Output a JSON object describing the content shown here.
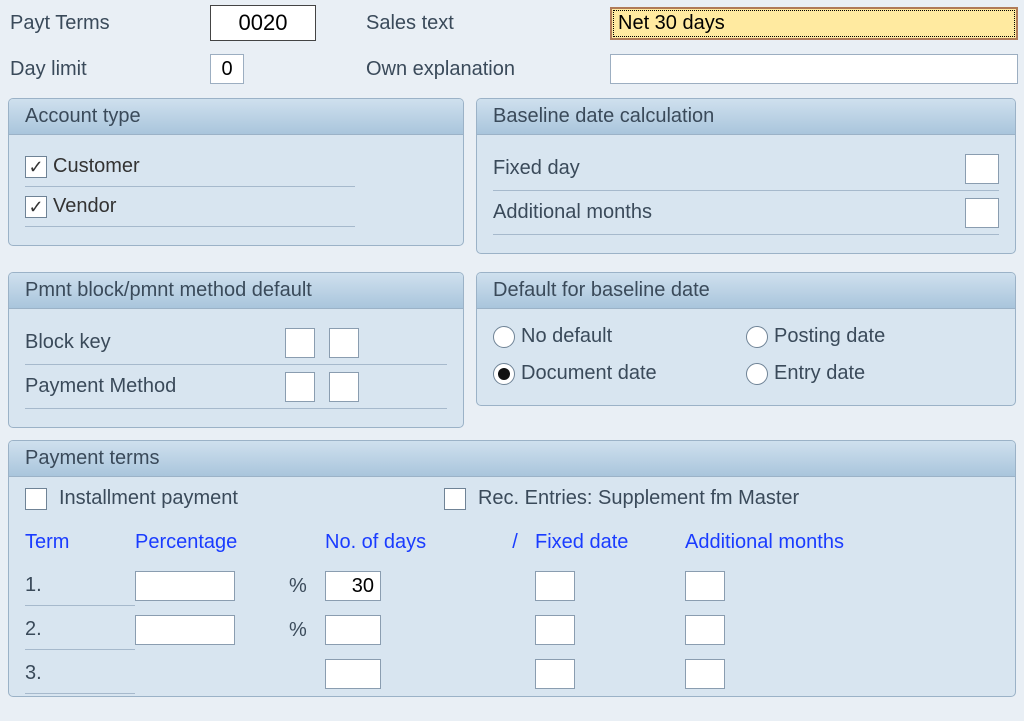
{
  "header": {
    "payt_terms_label": "Payt Terms",
    "payt_terms_value": "0020",
    "day_limit_label": "Day limit",
    "day_limit_value": "0",
    "sales_text_label": "Sales text",
    "sales_text_value": "Net 30 days",
    "own_explanation_label": "Own explanation",
    "own_explanation_value": ""
  },
  "account_type": {
    "title": "Account type",
    "customer_label": "Customer",
    "customer_checked": true,
    "vendor_label": "Vendor",
    "vendor_checked": true
  },
  "baseline_calc": {
    "title": "Baseline date calculation",
    "fixed_day_label": "Fixed day",
    "fixed_day_value": "",
    "additional_months_label": "Additional months",
    "additional_months_value": ""
  },
  "pmnt_block": {
    "title": "Pmnt block/pmnt method default",
    "block_key_label": "Block key",
    "payment_method_label": "Payment Method"
  },
  "baseline_default": {
    "title": "Default for baseline date",
    "no_default": "No default",
    "document_date": "Document date",
    "posting_date": "Posting date",
    "entry_date": "Entry date",
    "selected": "document_date"
  },
  "payment_terms": {
    "title": "Payment terms",
    "installment_label": "Installment payment",
    "rec_entries_label": "Rec. Entries: Supplement fm Master",
    "columns": {
      "term": "Term",
      "percentage": "Percentage",
      "no_of_days": "No. of days",
      "slash": "/",
      "fixed_date": "Fixed date",
      "additional_months": "Additional months"
    },
    "rows": [
      {
        "idx": "1.",
        "percentage": "",
        "days": "30",
        "fixed_date": "",
        "additional_months": ""
      },
      {
        "idx": "2.",
        "percentage": "",
        "days": "",
        "fixed_date": "",
        "additional_months": ""
      },
      {
        "idx": "3.",
        "percentage": "",
        "days": "",
        "fixed_date": "",
        "additional_months": ""
      }
    ]
  }
}
